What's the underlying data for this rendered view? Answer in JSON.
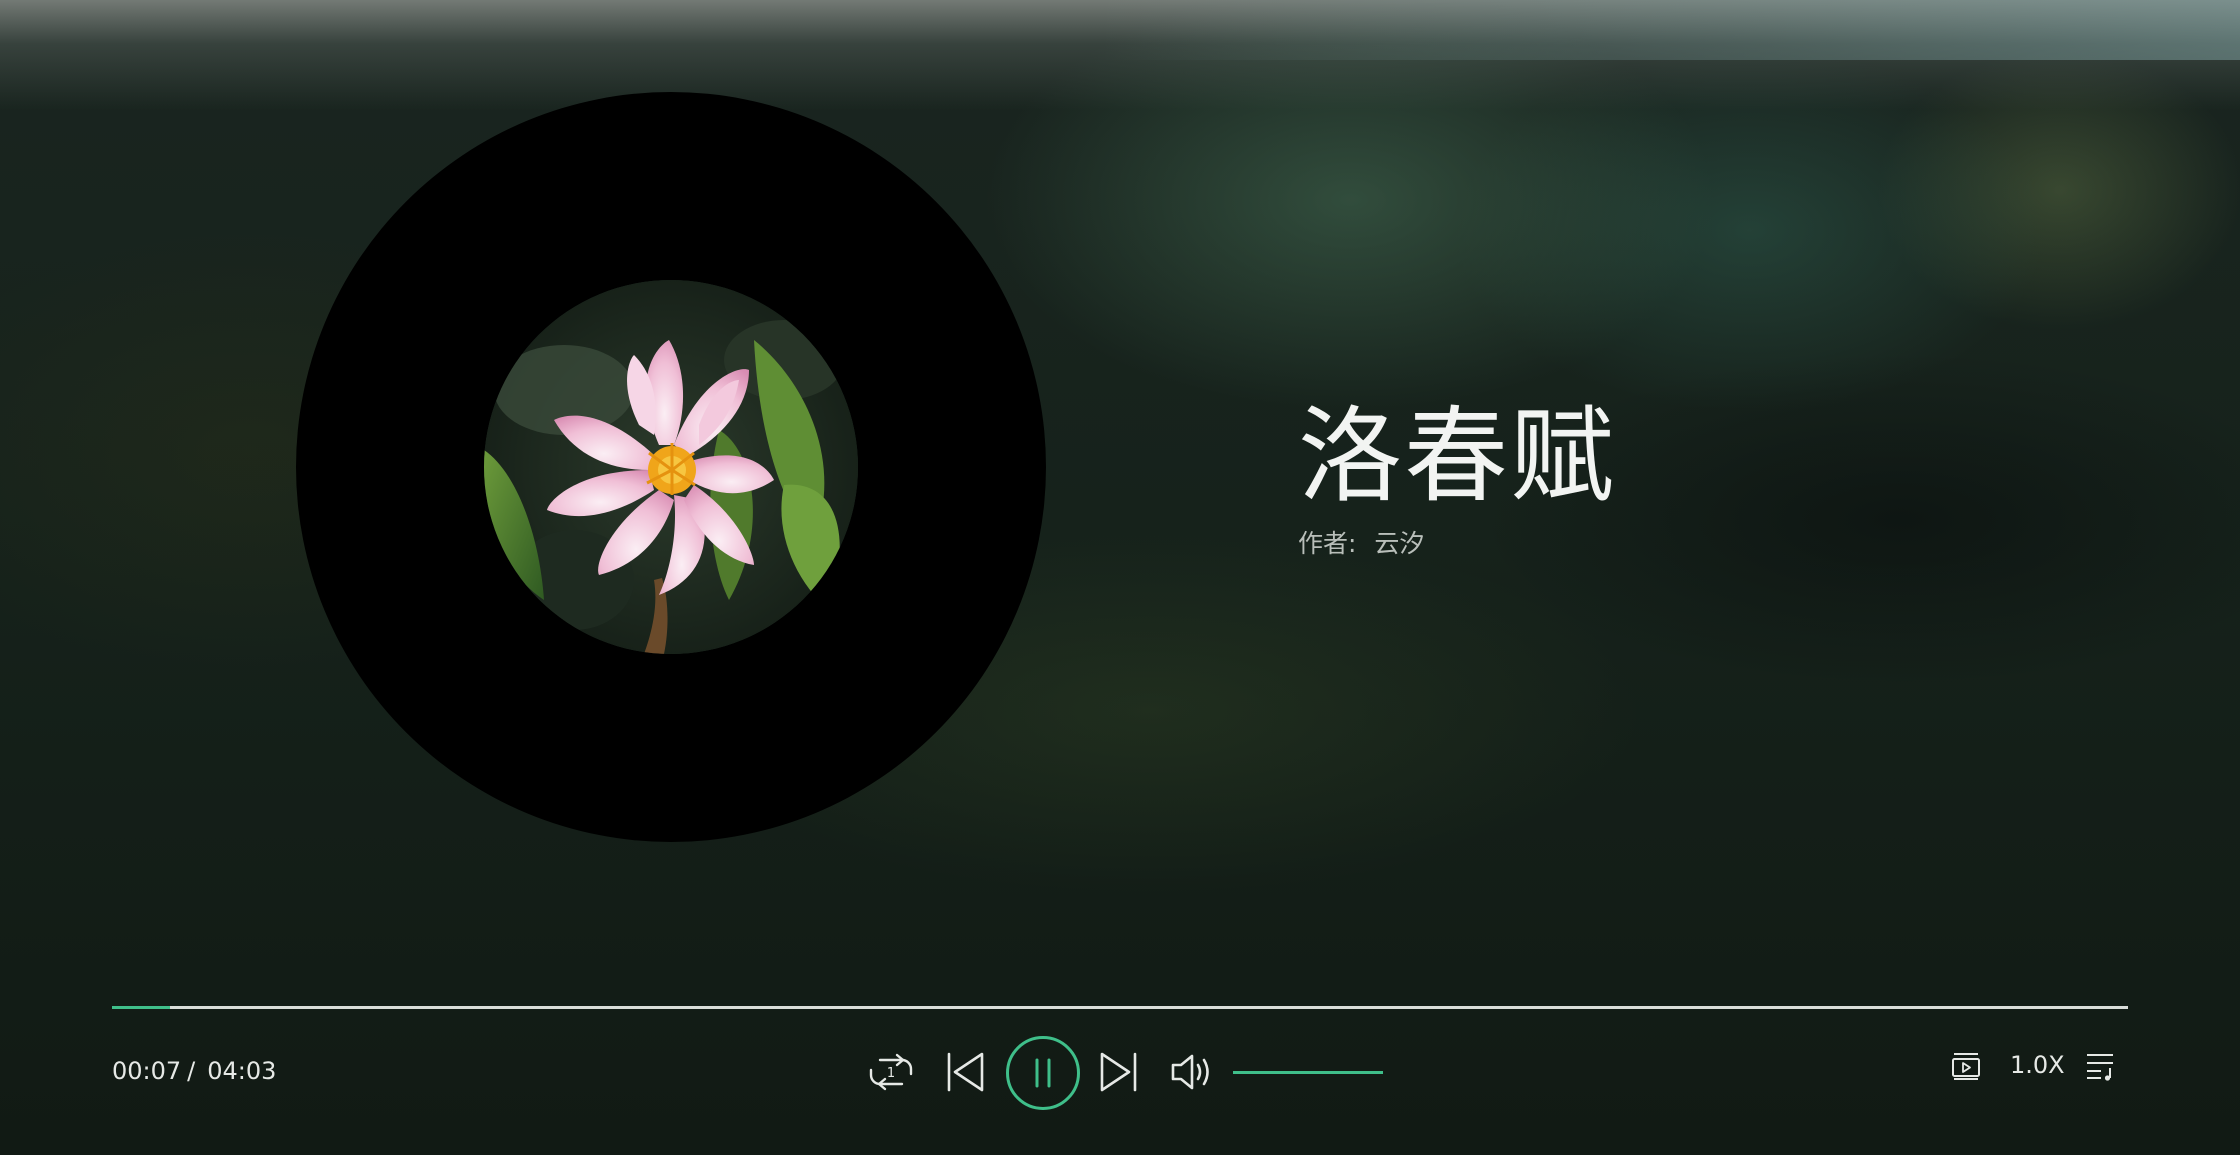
{
  "song": {
    "title": "洛春赋",
    "author_label": "作者:",
    "author_name": "云汐"
  },
  "playback": {
    "current_time": "00:07",
    "separator": "/",
    "total_time": "04:03",
    "progress_fraction": 0.029,
    "state": "playing",
    "speed_label": "1.0X"
  },
  "volume": {
    "level_fraction": 1.0
  },
  "icons": {
    "repeat": "repeat-one-icon",
    "previous": "skip-previous-icon",
    "play_pause": "pause-icon",
    "next": "skip-next-icon",
    "volume": "volume-icon",
    "video_mode": "video-icon",
    "playlist": "playlist-icon"
  },
  "colors": {
    "accent": "#3fbf8a",
    "text_primary": "#f2f4f2",
    "text_secondary": "#b9bfba"
  }
}
